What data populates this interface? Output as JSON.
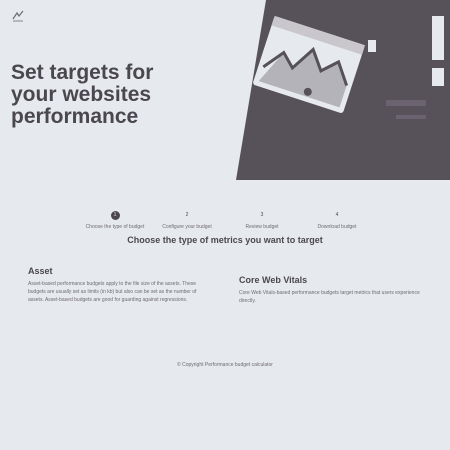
{
  "nav": {
    "items": [
      "",
      "",
      "",
      "",
      ""
    ]
  },
  "hero": {
    "title": "Set targets for\nyour websites\nperformance"
  },
  "steps": [
    {
      "number": "1",
      "label": "Choose the type of budget",
      "active": true
    },
    {
      "number": "2",
      "label": "Configure your budget",
      "active": false
    },
    {
      "number": "3",
      "label": "Review budget",
      "active": false
    },
    {
      "number": "4",
      "label": "Download budget",
      "active": false
    }
  ],
  "section_title": "Choose the type of metrics you want to target",
  "cards": [
    {
      "title": "Asset",
      "text": "Asset-based performance budgets apply to the file size of the assets. These budgets are usually set as limits (in kb) but also can be set as the number of assets. Asset-based budgets are good for guarding against regressions."
    },
    {
      "title": "Core Web Vitals",
      "text": "Core Web Vitals-based performance budgets target metrics that users experience directly."
    }
  ],
  "footer": {
    "text": "© Copyright Performance budget calculator"
  }
}
